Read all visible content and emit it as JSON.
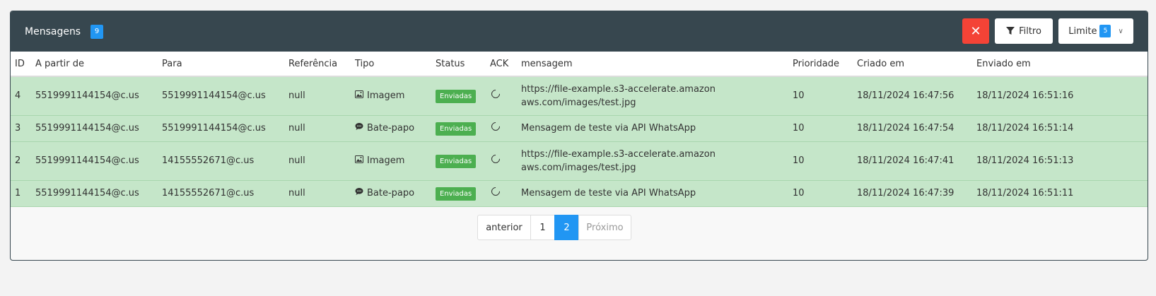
{
  "header": {
    "title": "Mensagens",
    "count": "9",
    "filter_label": "Filtro",
    "limit_label": "Limite",
    "limit_value": "5",
    "clear_icon": "close-icon"
  },
  "table": {
    "columns": [
      "ID",
      "A partir de",
      "Para",
      "Referência",
      "Tipo",
      "Status",
      "ACK",
      "mensagem",
      "Prioridade",
      "Criado em",
      "Enviado em"
    ],
    "rows": [
      {
        "id": "4",
        "from": "5519991144154@c.us",
        "to": "5519991144154@c.us",
        "ref": "null",
        "type": "Imagem",
        "type_icon": "image-icon",
        "status": "Enviadas",
        "message": "https://file-example.s3-accelerate.amazonaws.com/images/test.jpg",
        "priority": "10",
        "created": "18/11/2024 16:47:56",
        "sent": "18/11/2024 16:51:16"
      },
      {
        "id": "3",
        "from": "5519991144154@c.us",
        "to": "5519991144154@c.us",
        "ref": "null",
        "type": "Bate-papo",
        "type_icon": "chat-icon",
        "status": "Enviadas",
        "message": "Mensagem de teste via API WhatsApp",
        "priority": "10",
        "created": "18/11/2024 16:47:54",
        "sent": "18/11/2024 16:51:14"
      },
      {
        "id": "2",
        "from": "5519991144154@c.us",
        "to": "14155552671@c.us",
        "ref": "null",
        "type": "Imagem",
        "type_icon": "image-icon",
        "status": "Enviadas",
        "message": "https://file-example.s3-accelerate.amazonaws.com/images/test.jpg",
        "priority": "10",
        "created": "18/11/2024 16:47:41",
        "sent": "18/11/2024 16:51:13"
      },
      {
        "id": "1",
        "from": "5519991144154@c.us",
        "to": "14155552671@c.us",
        "ref": "null",
        "type": "Bate-papo",
        "type_icon": "chat-icon",
        "status": "Enviadas",
        "message": "Mensagem de teste via API WhatsApp",
        "priority": "10",
        "created": "18/11/2024 16:47:39",
        "sent": "18/11/2024 16:51:11"
      }
    ]
  },
  "pagination": {
    "prev": "anterior",
    "pages": [
      "1",
      "2"
    ],
    "active": "2",
    "next": "Próximo"
  },
  "colors": {
    "header_bg": "#37474f",
    "row_bg": "#c5e6c9",
    "status_green": "#4caf50",
    "accent_blue": "#2196f3",
    "danger_red": "#f44336"
  }
}
